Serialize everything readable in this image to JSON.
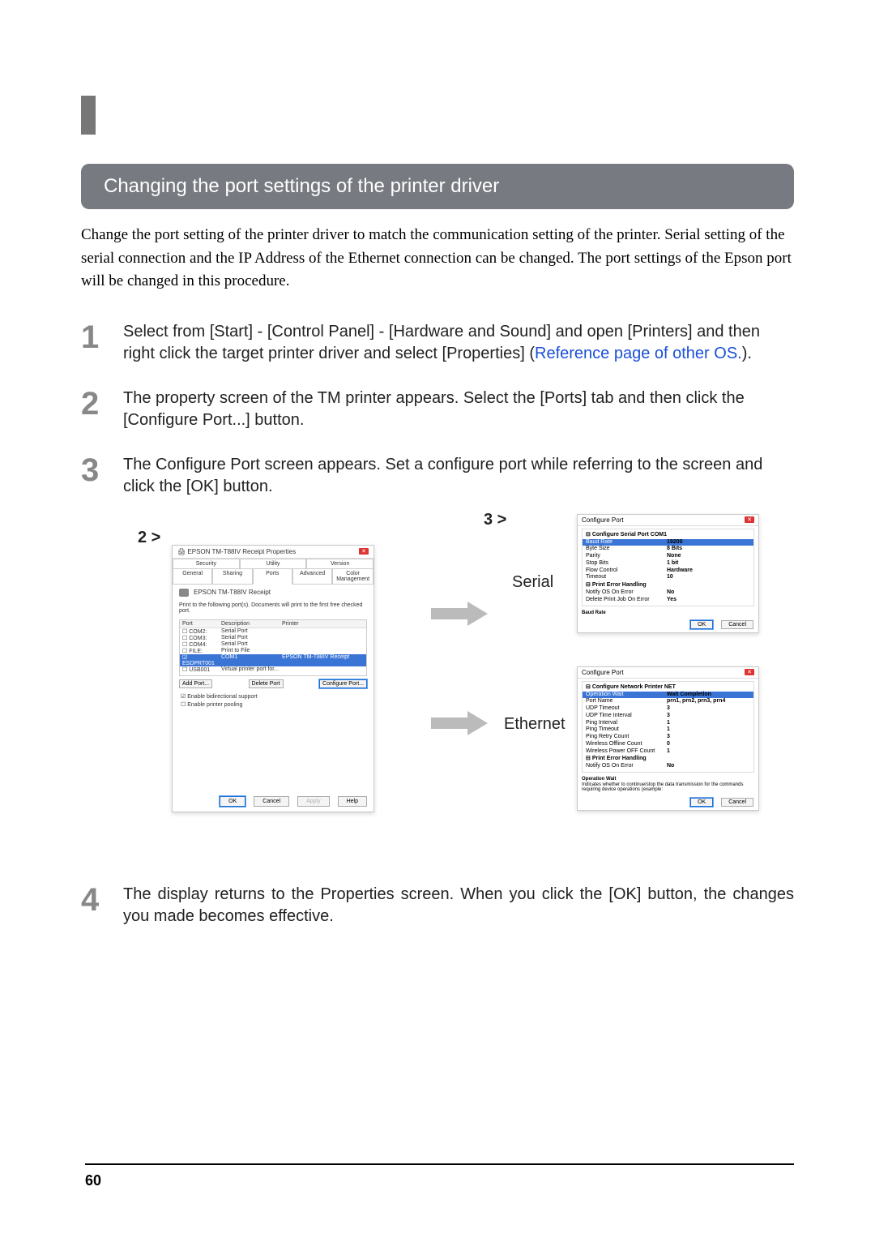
{
  "heading": "Changing the port settings of the printer driver",
  "intro": "Change the port setting of the printer driver to match the communication setting of the printer. Serial setting of the serial connection and the IP Address of the Ethernet connection can be changed. The port settings of the Epson port will be changed in this procedure.",
  "steps": {
    "s1_a": "Select from [Start] - [Control Panel] - [Hardware and Sound] and open [Printers] and then right click the target printer driver and select [Properties] (",
    "s1_link": "Reference page of other OS.",
    "s1_b": ").",
    "s2": "The property screen of the TM printer appears. Select the [Ports] tab and then click the [Configure Port...] button.",
    "s3": "The Configure Port screen appears. Set a configure port while referring to the screen and click the [OK] button.",
    "s4": "The display returns to the Properties screen. When you click the [OK] button, the changes you made becomes effective."
  },
  "labels": {
    "pane2": "2 >",
    "pane3": "3 >",
    "serial": "Serial",
    "ethernet": "Ethernet"
  },
  "dialogA": {
    "title": "EPSON TM-T88IV Receipt Properties",
    "tabs1": [
      "Security",
      "Utility",
      "Version"
    ],
    "tabs2": [
      "General",
      "Sharing",
      "Ports",
      "Advanced",
      "Color Management"
    ],
    "printer_name": "EPSON TM-T88IV Receipt",
    "desc": "Print to the following port(s). Documents will print to the first free checked port.",
    "head": [
      "Port",
      "Description",
      "Printer"
    ],
    "rows": [
      {
        "c1": "COM2:",
        "c2": "Serial Port",
        "c3": ""
      },
      {
        "c1": "COM3:",
        "c2": "Serial Port",
        "c3": ""
      },
      {
        "c1": "COM4:",
        "c2": "Serial Port",
        "c3": ""
      },
      {
        "c1": "FILE:",
        "c2": "Print to File",
        "c3": ""
      },
      {
        "c1": "ESDPRT001",
        "c2": "COM1",
        "c3": "EPSON TM-T88IV Receipt",
        "sel": true
      },
      {
        "c1": "USB001",
        "c2": "Virtual printer port for...",
        "c3": ""
      }
    ],
    "add": "Add Port...",
    "delete": "Delete Port",
    "config": "Configure Port...",
    "chk1": "Enable bidirectional support",
    "chk2": "Enable printer pooling",
    "ok": "OK",
    "cancel": "Cancel",
    "apply": "Apply",
    "help": "Help"
  },
  "dialogSerial": {
    "title": "Configure Port",
    "group1": "Configure Serial Port COM1",
    "rows1": [
      {
        "k": "Baud Rate",
        "v": "19200",
        "sel": true
      },
      {
        "k": "Byte Size",
        "v": "8 Bits"
      },
      {
        "k": "Parity",
        "v": "None"
      },
      {
        "k": "Stop Bits",
        "v": "1 bit"
      },
      {
        "k": "Flow Control",
        "v": "Hardware"
      },
      {
        "k": "Timeout",
        "v": "10"
      }
    ],
    "group2": "Print Error Handling",
    "rows2": [
      {
        "k": "Notify OS On Error",
        "v": "No"
      },
      {
        "k": "Delete Print Job On Error",
        "v": "Yes"
      }
    ],
    "help_label": "Baud Rate",
    "ok": "OK",
    "cancel": "Cancel"
  },
  "dialogNet": {
    "title": "Configure Port",
    "group1": "Configure Network Printer NET",
    "rows1": [
      {
        "k": "Operation Wait",
        "v": "Wait Completion",
        "sel": true
      },
      {
        "k": "Port Name",
        "v": "prn1, prn2, prn3, prn4"
      },
      {
        "k": "UDP Timeout",
        "v": "3"
      },
      {
        "k": "UDP Time Interval",
        "v": "3"
      },
      {
        "k": "Ping Interval",
        "v": "1"
      },
      {
        "k": "Ping Timeout",
        "v": "1"
      },
      {
        "k": "Ping Retry Count",
        "v": "3"
      },
      {
        "k": "Wireless Offline Count",
        "v": "0"
      },
      {
        "k": "Wireless Power OFF Count",
        "v": "1"
      }
    ],
    "group2": "Print Error Handling",
    "rows2": [
      {
        "k": "Notify OS On Error",
        "v": "No"
      }
    ],
    "help_label": "Operation Wait",
    "help_text": "Indicates whether to continue/stop the data transmission for the commands requiring device operations (example:",
    "ok": "OK",
    "cancel": "Cancel"
  },
  "page_num": "60"
}
